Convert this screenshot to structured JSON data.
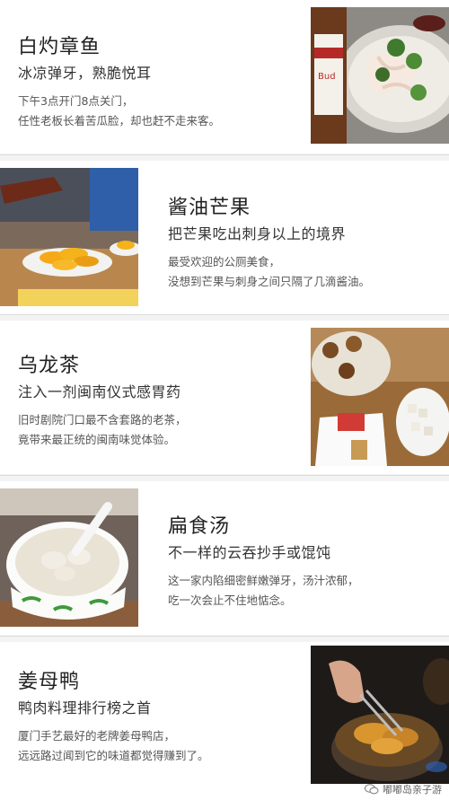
{
  "items": [
    {
      "title": "白灼章鱼",
      "subtitle": "冰凉弹牙，熟脆悦耳",
      "desc1": "下午3点开门8点关门，",
      "desc2": "任性老板长着苦瓜脸，却也赶不走来客。"
    },
    {
      "title": "酱油芒果",
      "subtitle": "把芒果吃出刺身以上的境界",
      "desc1": "最受欢迎的公厕美食，",
      "desc2": "没想到芒果与刺身之间只隔了几滴酱油。"
    },
    {
      "title": "乌龙茶",
      "subtitle": "注入一剂闽南仪式感胃药",
      "desc1": "旧时剧院门口最不含套路的老茶，",
      "desc2": "竟带来最正统的闽南味觉体验。"
    },
    {
      "title": "扁食汤",
      "subtitle": "不一样的云吞抄手或馄饨",
      "desc1": "这一家内陷细密鲜嫩弹牙，汤汁浓郁，",
      "desc2": "吃一次会止不住地惦念。"
    },
    {
      "title": "姜母鸭",
      "subtitle": "鸭肉料理排行榜之首",
      "desc1": "厦门手艺最好的老牌姜母鸭店，",
      "desc2": "远远路过闻到它的味道都觉得赚到了。"
    }
  ],
  "watermark": "嘟嘟岛亲子游"
}
